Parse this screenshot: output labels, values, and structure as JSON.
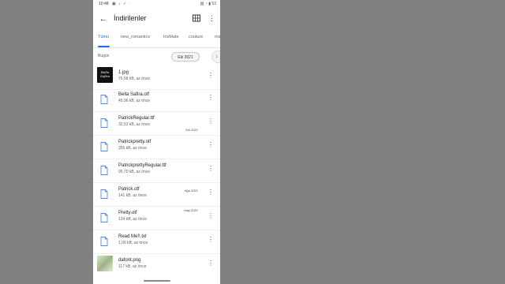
{
  "status_bar": {
    "time": "10:48",
    "left_icons": "▣ ♪ ✓ ·",
    "right_icons": "▨ ◔ ▮ 53"
  },
  "app_bar": {
    "title": "İndirilenler"
  },
  "tabs": [
    {
      "label": "Tümü",
      "active": true
    },
    {
      "label": "new_romantics",
      "active": false
    },
    {
      "label": "InsMate",
      "active": false
    },
    {
      "label": "couture",
      "active": false
    },
    {
      "label": "ma",
      "active": false
    }
  ],
  "section": {
    "label": "Bugün",
    "date_chip": "Eki 2021"
  },
  "files": [
    {
      "name": "1.jpg",
      "meta": "76,58 kB, az önce",
      "thumb": "dark",
      "thumb_text": "Bella Safira",
      "tag": ""
    },
    {
      "name": "Bella Safira.otf",
      "meta": "45,96 kB, az önce",
      "thumb": "doc",
      "tag": ""
    },
    {
      "name": "PatrickRegular.ttf",
      "meta": "32,53 kB, az önce",
      "thumb": "doc",
      "tag": "Eki 2021"
    },
    {
      "name": "Patrickpretty.otf",
      "meta": "355 kB, az önce",
      "thumb": "doc",
      "tag": ""
    },
    {
      "name": "PatrickprettyRegular.ttf",
      "meta": "95,70 kB, az önce",
      "thumb": "doc",
      "tag": ""
    },
    {
      "name": "Patrick.otf",
      "meta": "141 kB, az önce",
      "thumb": "doc",
      "tag": "Ağu 2021"
    },
    {
      "name": "Pretty.otf",
      "meta": "124 kB, az önce",
      "thumb": "doc",
      "tag": "May 2021"
    },
    {
      "name": "Read Me!!.txt",
      "meta": "1,00 kB, az önce",
      "thumb": "doc",
      "tag": ""
    },
    {
      "name": "dafont.png",
      "meta": "117 kB, az önce",
      "thumb": "green",
      "tag": ""
    }
  ],
  "colors": {
    "accent": "#1a73e8",
    "file_icon": "#4a8af4",
    "background": "#808080"
  }
}
